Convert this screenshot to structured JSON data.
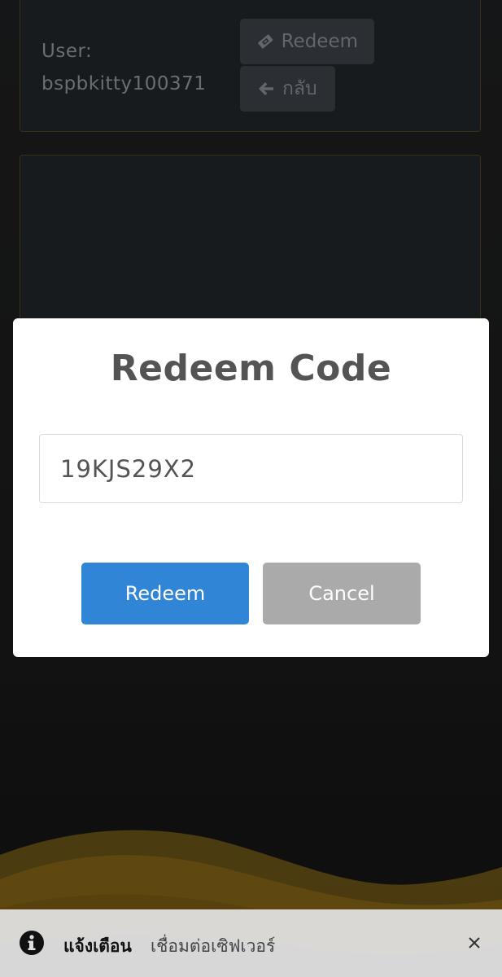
{
  "user": {
    "label": "User:",
    "name": "bspbkitty100371"
  },
  "top_buttons": {
    "redeem_label": "Redeem",
    "back_label": "กลับ"
  },
  "modal": {
    "title": "Redeem Code",
    "input_value": "19KJS29X2",
    "confirm_label": "Redeem",
    "cancel_label": "Cancel"
  },
  "notification": {
    "title": "แจ้งเตือน",
    "message": "เชื่อมต่อเซิฟเวอร์"
  },
  "colors": {
    "confirm": "#3085d6",
    "cancel": "#aaaaaa",
    "wave": "#c8961b"
  }
}
